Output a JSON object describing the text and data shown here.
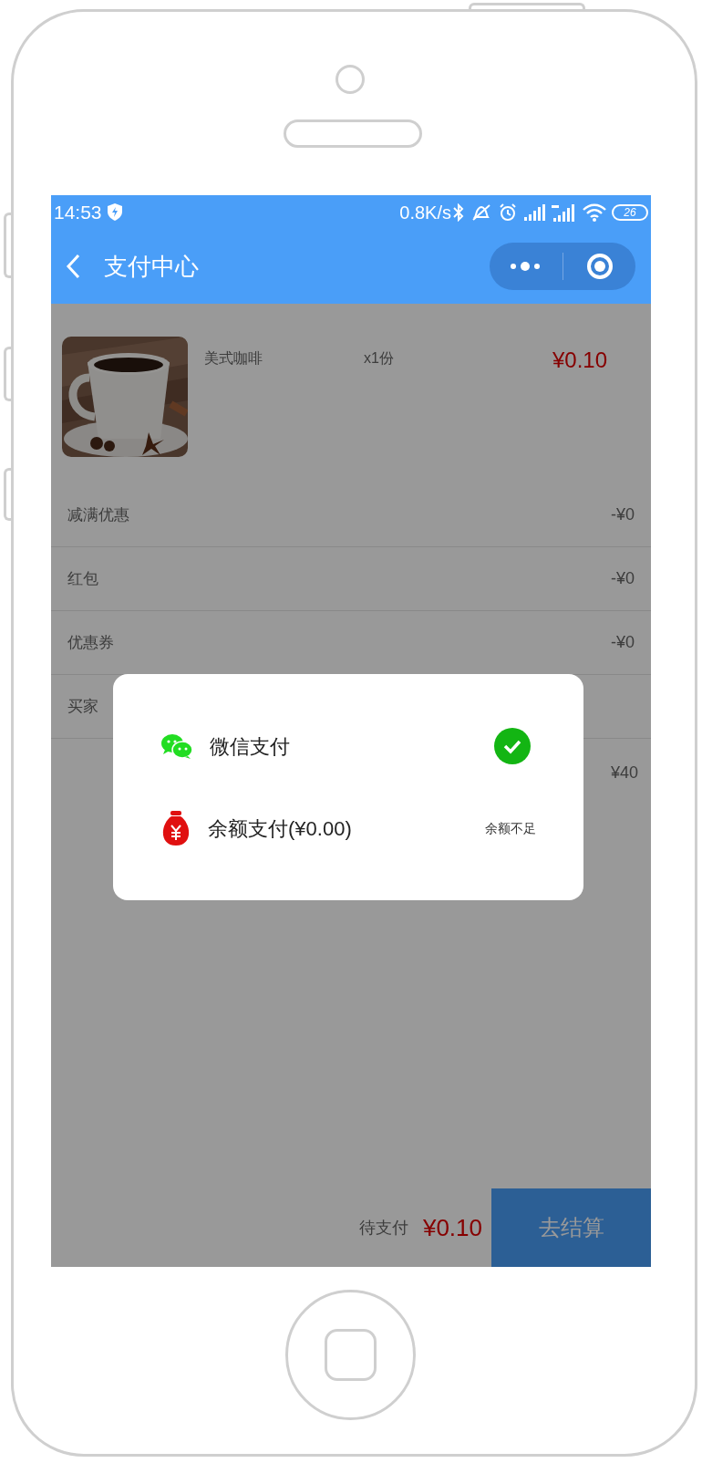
{
  "status_bar": {
    "time": "14:53",
    "network_speed": "0.8K/s",
    "battery": "26"
  },
  "header": {
    "title": "支付中心"
  },
  "product": {
    "name": "美式咖啡",
    "quantity": "x1份",
    "price": "¥0.10"
  },
  "summary_rows": [
    {
      "label": "减满优惠",
      "value": "-¥0"
    },
    {
      "label": "红包",
      "value": "-¥0"
    },
    {
      "label": "优惠券",
      "value": "-¥0"
    },
    {
      "label": "买家"
    }
  ],
  "extra_value": "¥40",
  "payment_dialog": {
    "options": [
      {
        "kind": "wechat",
        "label": "微信支付",
        "selected": true
      },
      {
        "kind": "balance",
        "label": "余额支付(¥0.00)",
        "selected": false,
        "note": "余额不足"
      }
    ]
  },
  "footer": {
    "label": "待支付",
    "total": "¥0.10",
    "button": "去结算"
  }
}
